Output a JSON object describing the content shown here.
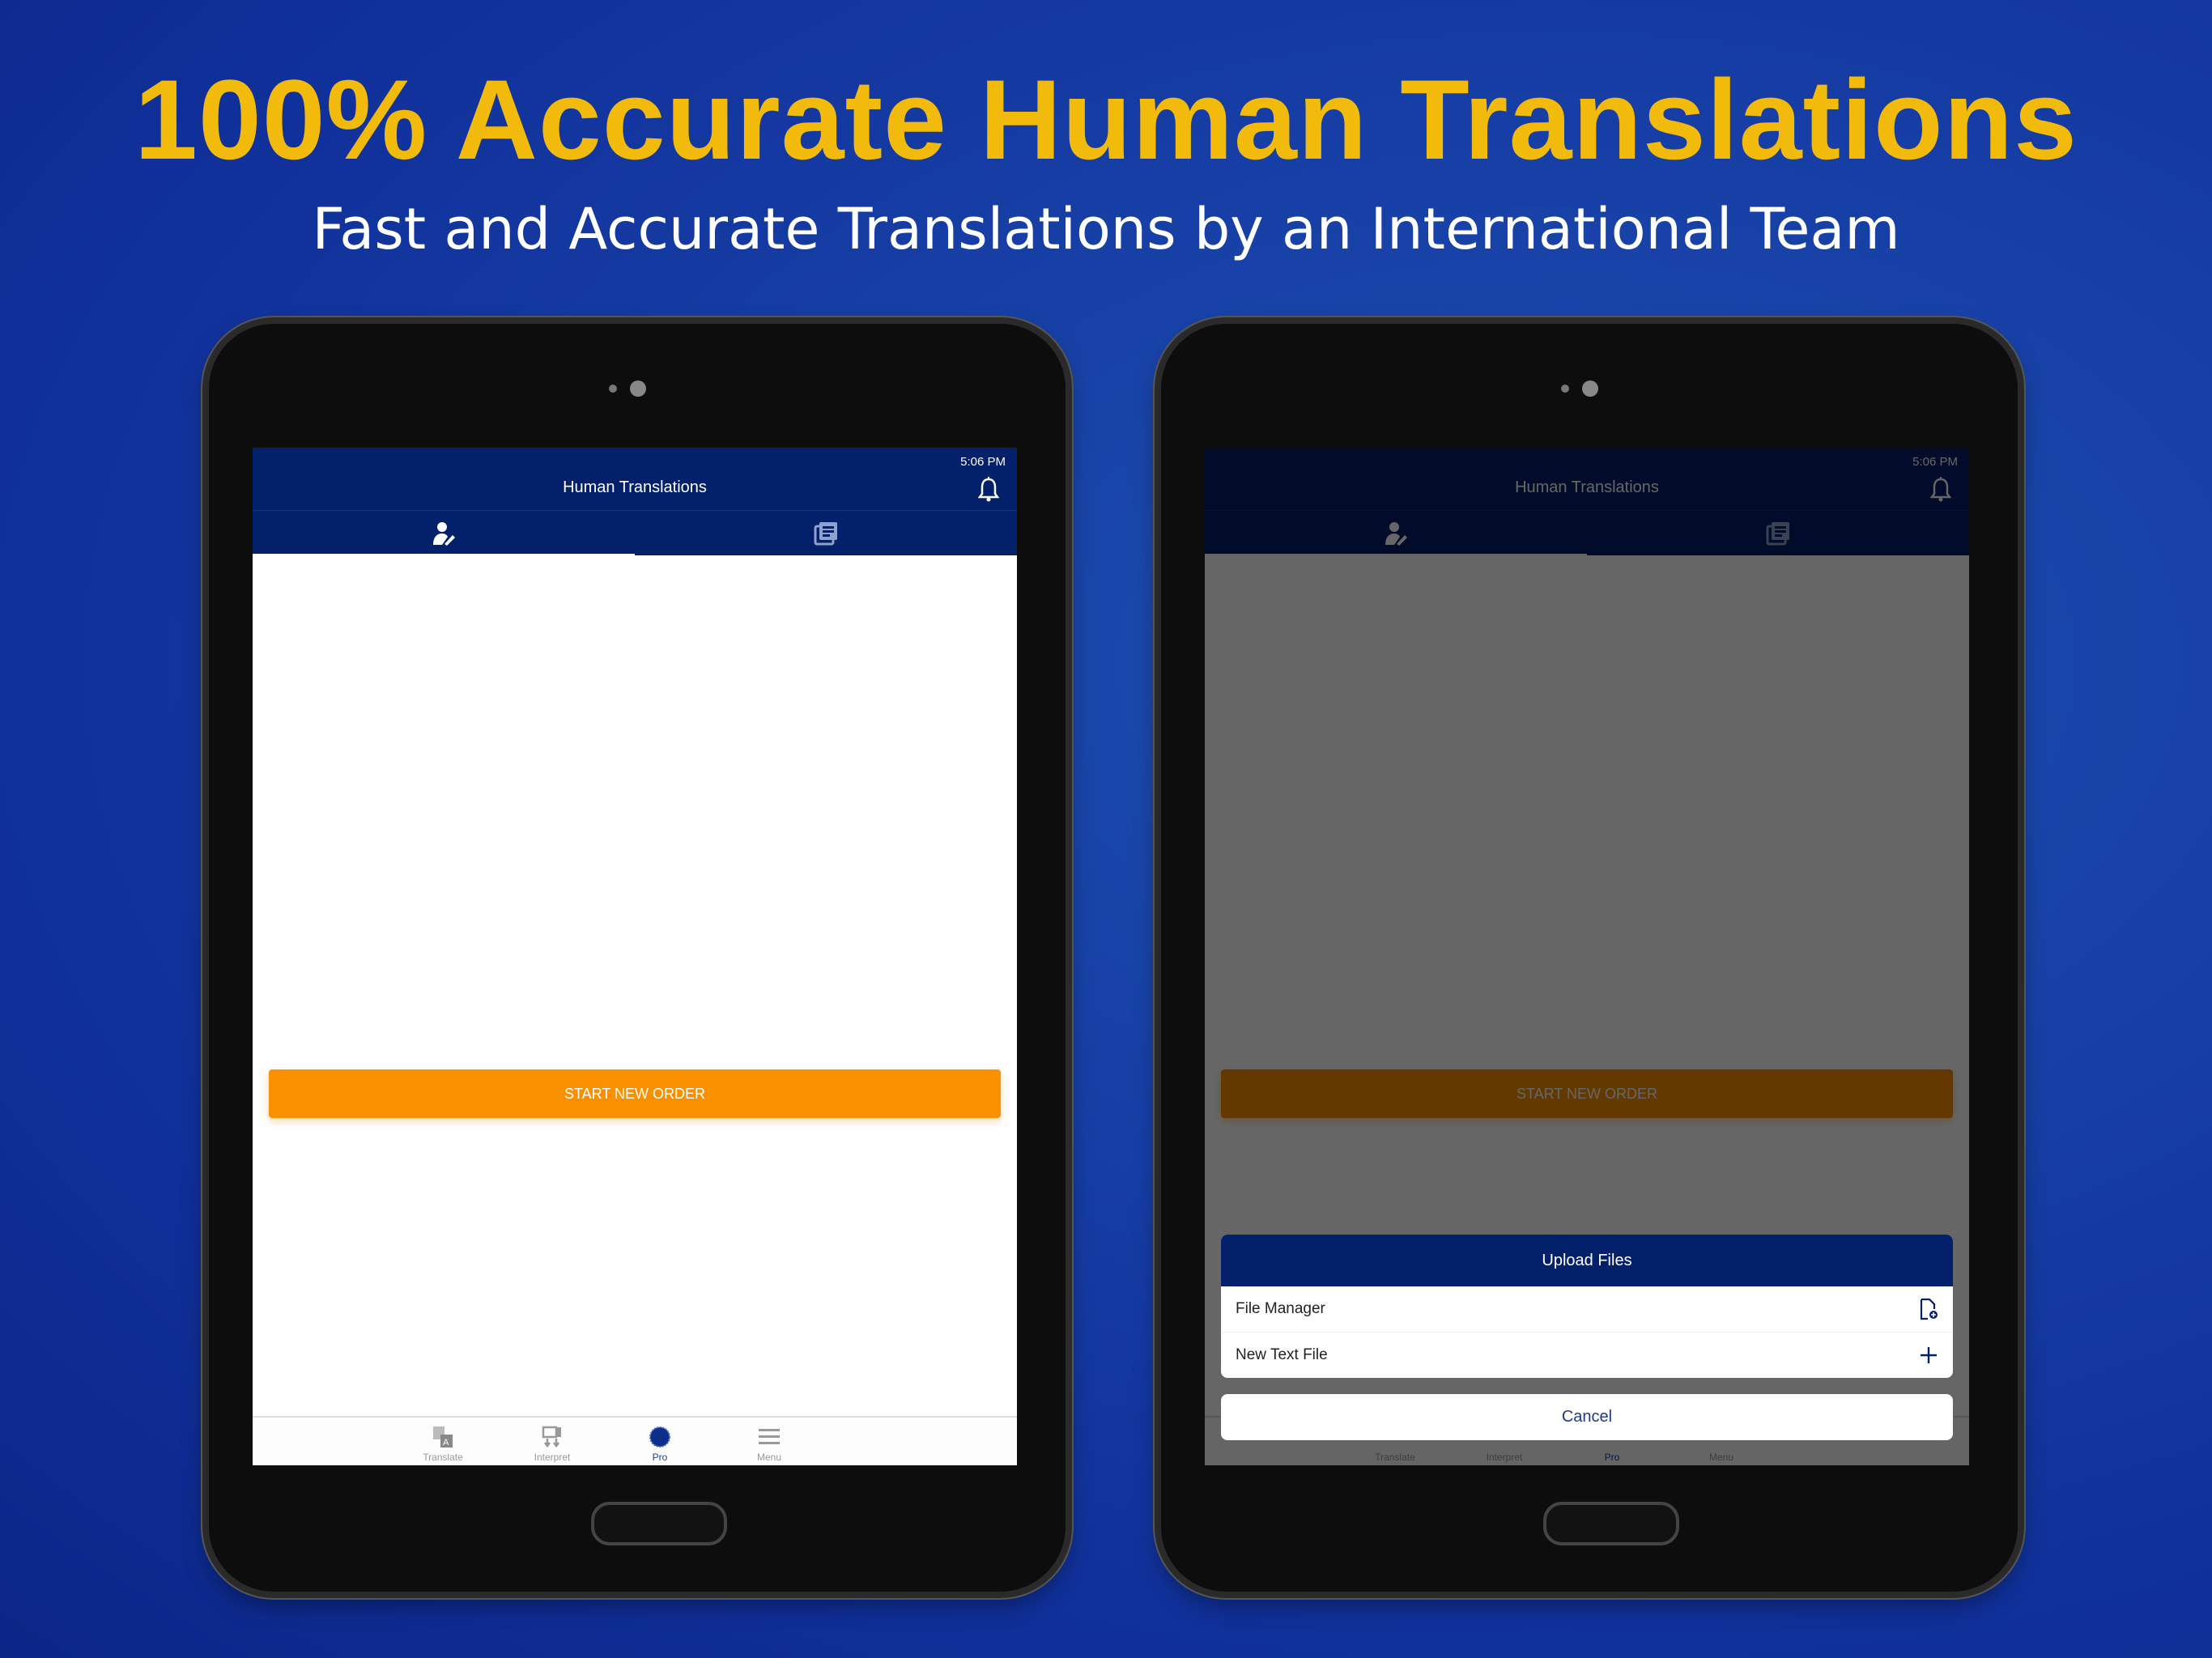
{
  "banner": {
    "headline": "100% Accurate Human Translations",
    "subheadline": "Fast and Accurate Translations by an International Team"
  },
  "colors": {
    "headline": "#f2bb0b",
    "app_primary": "#03206a",
    "accent_orange": "#f99000",
    "active_nav": "#1d3f93"
  },
  "left_device": {
    "status_time": "5:06 PM",
    "app_title": "Human Translations",
    "header_icon": "bell-icon",
    "tabs": [
      {
        "icon": "translator-person-icon",
        "active": true
      },
      {
        "icon": "documents-list-icon",
        "active": false
      }
    ],
    "start_button_label": "START NEW ORDER",
    "bottom_nav": [
      {
        "label": "Translate",
        "icon": "translate-icon",
        "active": false
      },
      {
        "label": "Interpret",
        "icon": "interpret-icon",
        "active": false
      },
      {
        "label": "Pro",
        "icon": "pro-badge-icon",
        "active": true
      },
      {
        "label": "Menu",
        "icon": "menu-icon",
        "active": false
      }
    ]
  },
  "right_device": {
    "status_time": "5:06 PM",
    "app_title": "Human Translations",
    "start_button_label": "START NEW ORDER",
    "bottom_nav": [
      {
        "label": "Translate"
      },
      {
        "label": "Interpret"
      },
      {
        "label": "Pro"
      },
      {
        "label": "Menu"
      }
    ],
    "action_sheet": {
      "title": "Upload Files",
      "options": [
        {
          "label": "File Manager",
          "icon": "file-add-icon"
        },
        {
          "label": "New Text File",
          "icon": "plus-icon"
        }
      ],
      "cancel_label": "Cancel"
    }
  }
}
